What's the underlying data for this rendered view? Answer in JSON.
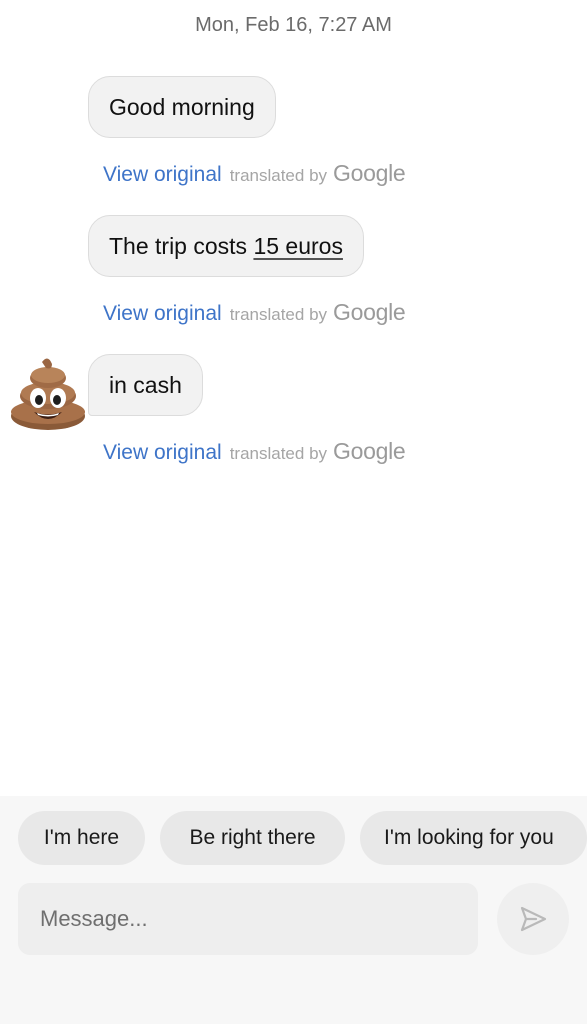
{
  "timestamp": "Mon, Feb 16, 7:27 AM",
  "messages": [
    {
      "text": "Good morning",
      "view_original": "View original",
      "translated_by": "translated by",
      "provider": "Google"
    },
    {
      "text_before": "The trip costs ",
      "text_number": "15 euros",
      "view_original": "View original",
      "translated_by": "translated by",
      "provider": "Google"
    },
    {
      "text": "in cash",
      "view_original": "View original",
      "translated_by": "translated by",
      "provider": "Google"
    }
  ],
  "sender_avatar": {
    "icon": "pile-of-poo-emoji-icon"
  },
  "quick_replies": [
    "I'm here",
    "Be right there",
    "I'm looking for you"
  ],
  "composer": {
    "placeholder": "Message..."
  },
  "send_icon": "send-arrow-icon",
  "colors": {
    "link": "#3e74c8",
    "bubble": "#f2f2f2",
    "chip": "#e8e8e8",
    "panel": "#f7f7f7"
  }
}
